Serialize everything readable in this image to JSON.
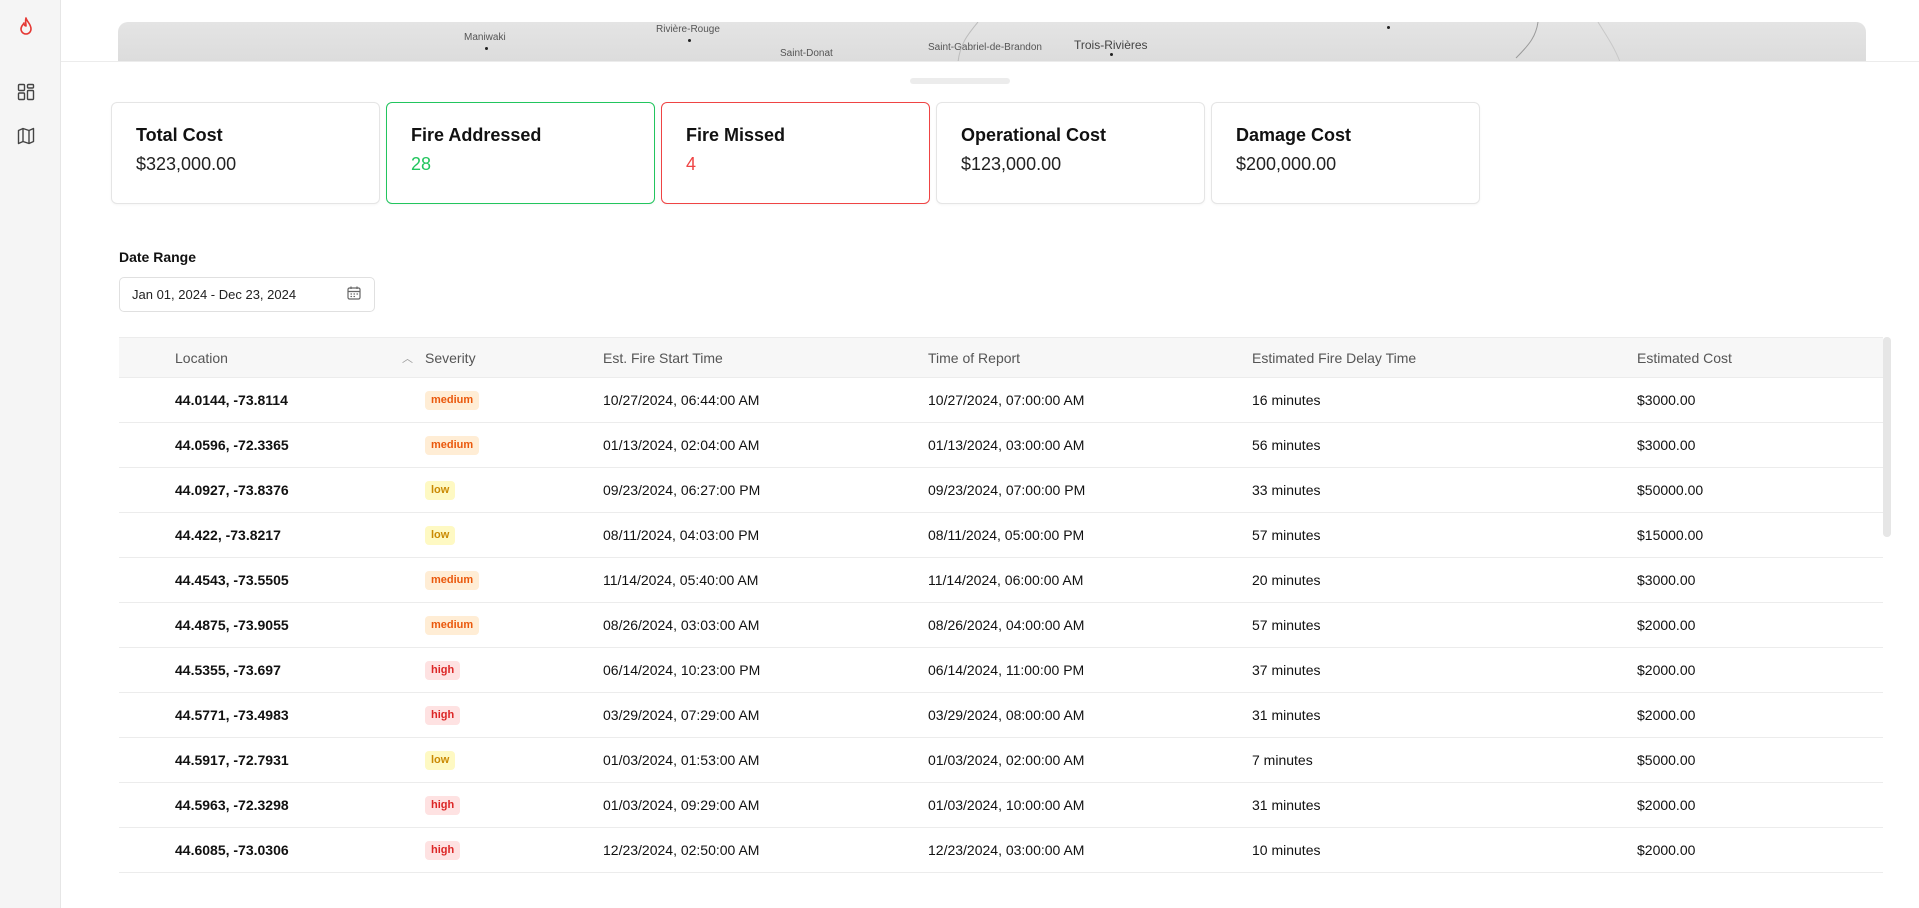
{
  "sidebar": {
    "logo_icon": "flame-icon",
    "items": [
      {
        "icon": "dashboard-icon"
      },
      {
        "icon": "map-icon"
      }
    ]
  },
  "map": {
    "labels": [
      "Maniwaki",
      "Rivière-Rouge",
      "Saint-Donat",
      "Saint-Gabriel-de-Brandon",
      "Trois-Rivières"
    ]
  },
  "cards": [
    {
      "title": "Total Cost",
      "value": "$323,000.00",
      "variant": "default"
    },
    {
      "title": "Fire Addressed",
      "value": "28",
      "variant": "green"
    },
    {
      "title": "Fire Missed",
      "value": "4",
      "variant": "red"
    },
    {
      "title": "Operational Cost",
      "value": "$123,000.00",
      "variant": "default"
    },
    {
      "title": "Damage Cost",
      "value": "$200,000.00",
      "variant": "default"
    }
  ],
  "date_range": {
    "label": "Date Range",
    "value": "Jan 01, 2024 - Dec 23, 2024"
  },
  "table": {
    "columns": [
      "Location",
      "Severity",
      "Est. Fire Start Time",
      "Time of Report",
      "Estimated Fire Delay Time",
      "Estimated Cost"
    ],
    "rows": [
      {
        "location": "44.0144, -73.8114",
        "severity": "medium",
        "start": "10/27/2024, 06:44:00 AM",
        "report": "10/27/2024, 07:00:00 AM",
        "delay": "16 minutes",
        "cost": "$3000.00"
      },
      {
        "location": "44.0596, -72.3365",
        "severity": "medium",
        "start": "01/13/2024, 02:04:00 AM",
        "report": "01/13/2024, 03:00:00 AM",
        "delay": "56 minutes",
        "cost": "$3000.00"
      },
      {
        "location": "44.0927, -73.8376",
        "severity": "low",
        "start": "09/23/2024, 06:27:00 PM",
        "report": "09/23/2024, 07:00:00 PM",
        "delay": "33 minutes",
        "cost": "$50000.00"
      },
      {
        "location": "44.422, -73.8217",
        "severity": "low",
        "start": "08/11/2024, 04:03:00 PM",
        "report": "08/11/2024, 05:00:00 PM",
        "delay": "57 minutes",
        "cost": "$15000.00"
      },
      {
        "location": "44.4543, -73.5505",
        "severity": "medium",
        "start": "11/14/2024, 05:40:00 AM",
        "report": "11/14/2024, 06:00:00 AM",
        "delay": "20 minutes",
        "cost": "$3000.00"
      },
      {
        "location": "44.4875, -73.9055",
        "severity": "medium",
        "start": "08/26/2024, 03:03:00 AM",
        "report": "08/26/2024, 04:00:00 AM",
        "delay": "57 minutes",
        "cost": "$2000.00"
      },
      {
        "location": "44.5355, -73.697",
        "severity": "high",
        "start": "06/14/2024, 10:23:00 PM",
        "report": "06/14/2024, 11:00:00 PM",
        "delay": "37 minutes",
        "cost": "$2000.00"
      },
      {
        "location": "44.5771, -73.4983",
        "severity": "high",
        "start": "03/29/2024, 07:29:00 AM",
        "report": "03/29/2024, 08:00:00 AM",
        "delay": "31 minutes",
        "cost": "$2000.00"
      },
      {
        "location": "44.5917, -72.7931",
        "severity": "low",
        "start": "01/03/2024, 01:53:00 AM",
        "report": "01/03/2024, 02:00:00 AM",
        "delay": "7 minutes",
        "cost": "$5000.00"
      },
      {
        "location": "44.5963, -72.3298",
        "severity": "high",
        "start": "01/03/2024, 09:29:00 AM",
        "report": "01/03/2024, 10:00:00 AM",
        "delay": "31 minutes",
        "cost": "$2000.00"
      },
      {
        "location": "44.6085, -73.0306",
        "severity": "high",
        "start": "12/23/2024, 02:50:00 AM",
        "report": "12/23/2024, 03:00:00 AM",
        "delay": "10 minutes",
        "cost": "$2000.00"
      }
    ]
  },
  "colors": {
    "accent_red": "#ef4444",
    "accent_green": "#22c55e",
    "badge_medium": "#ea580c",
    "badge_low": "#ca8a04",
    "badge_high": "#dc2626"
  }
}
